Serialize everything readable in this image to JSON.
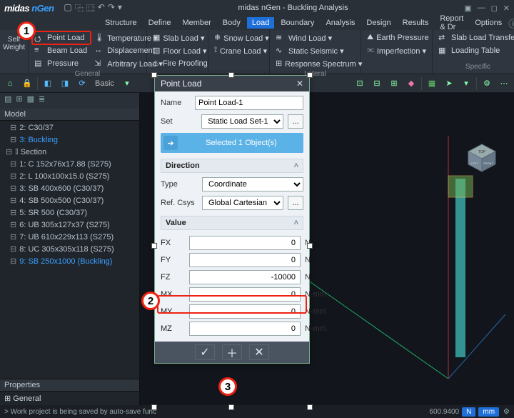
{
  "app": {
    "brand_a": "midas",
    "brand_b": " nGen",
    "title": "midas nGen - Buckling Analysis"
  },
  "menubar": {
    "items": [
      "Structure",
      "Define",
      "Member",
      "Body",
      "Load",
      "Boundary",
      "Analysis",
      "Design",
      "Results",
      "Report & Dr",
      "Options"
    ],
    "active": "Load"
  },
  "ribbon": {
    "general_label": "General",
    "self_weight": "Self\nWeight",
    "point_load": "Point Load",
    "beam_load": "Beam Load",
    "pressure": "Pressure",
    "temperature": "Temperature ▾",
    "displacement": "Displacement",
    "arbitrary": "Arbitrary Load ▾",
    "slab_load": "Slab Load ▾",
    "floor_load": "Floor Load ▾",
    "fire": "Fire Proofing",
    "snow": "Snow Load ▾",
    "crane": "Crane Load ▾",
    "lateral_label": "Lateral",
    "wind": "Wind Load ▾",
    "seismic": "Static Seismic ▾",
    "response": "Response Spectrum ▾",
    "earth": "Earth Pressure",
    "imperfection": "Imperfection ▾",
    "specific_label": "Specific",
    "slab_transfer": "Slab Load Transfer",
    "loading_table": "Loading Table"
  },
  "toolstrip": {
    "basic": "Basic"
  },
  "model": {
    "header": "Model",
    "nodes": [
      "2: C30/37",
      "3: Buckling",
      "𝕀 Section",
      "1: C 152x76x17.88 (S275)",
      "2: L 100x100x15.0 (S275)",
      "3: SB 400x600 (C30/37)",
      "4: SB 500x500 (C30/37)",
      "5: SR 500 (C30/37)",
      "6: UB 305x127x37 (S275)",
      "7: UB 610x229x113 (S275)",
      "8: UC 305x305x118 (S275)",
      "9: SB 250x1000 (Buckling)"
    ],
    "sel_index": 1,
    "sel2_index": 11,
    "properties": "Properties",
    "general": "General"
  },
  "dialog": {
    "title": "Point Load",
    "name_label": "Name",
    "name_value": "Point Load-1",
    "set_label": "Set",
    "set_value": "Static Load Set-1",
    "selected": "Selected 1 Object(s)",
    "direction": "Direction",
    "type_label": "Type",
    "type_value": "Coordinate",
    "csys_label": "Ref. Csys",
    "csys_value": "Global Cartesian",
    "value": "Value",
    "rows": [
      {
        "k": "FX",
        "v": "0",
        "u": "N"
      },
      {
        "k": "FY",
        "v": "0",
        "u": "N"
      },
      {
        "k": "FZ",
        "v": "-10000",
        "u": "N"
      },
      {
        "k": "MX",
        "v": "0",
        "u": "N·mm"
      },
      {
        "k": "MY",
        "v": "0",
        "u": "N·mm"
      },
      {
        "k": "MZ",
        "v": "0",
        "u": "N·mm"
      }
    ]
  },
  "status": {
    "msg": "> Work project is being saved by auto-save func",
    "coord": "600.9400",
    "unit1": "N",
    "unit2": "mm"
  },
  "annotations": {
    "b1": "1",
    "b2": "2",
    "b3": "3"
  }
}
